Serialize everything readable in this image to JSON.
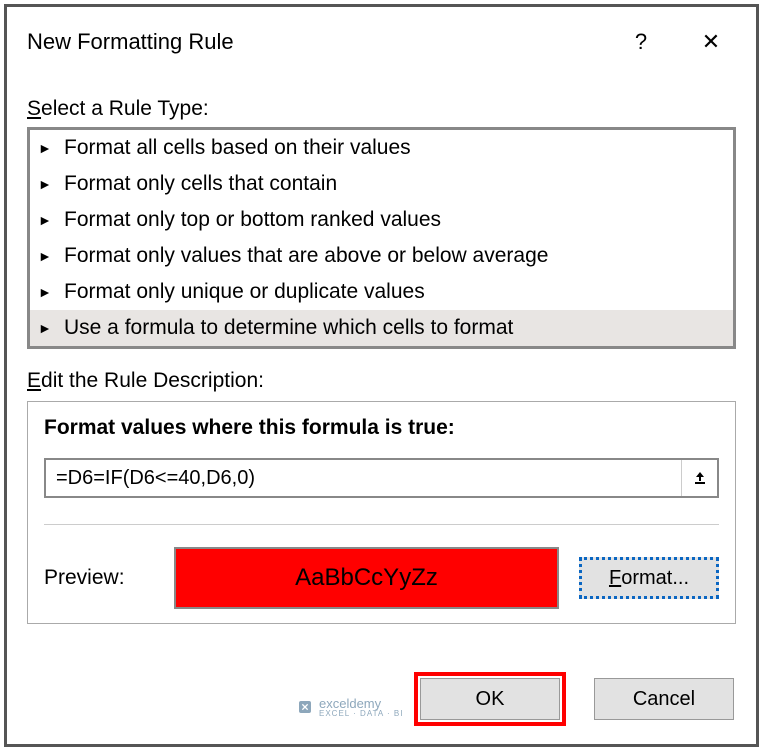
{
  "titlebar": {
    "title": "New Formatting Rule",
    "help": "?",
    "close": "✕"
  },
  "ruleType": {
    "label_pre": "S",
    "label_post": "elect a Rule Type:",
    "items": [
      "Format all cells based on their values",
      "Format only cells that contain",
      "Format only top or bottom ranked values",
      "Format only values that are above or below average",
      "Format only unique or duplicate values",
      "Use a formula to determine which cells to format"
    ]
  },
  "ruleDesc": {
    "label_pre": "E",
    "label_post": "dit the Rule Description:",
    "formulaLabel": "Format values where this formula is true:",
    "formulaValue": "=D6=IF(D6<=40,D6,0)",
    "previewLabel": "Preview:",
    "previewSample": "AaBbCcYyZz",
    "formatBtn_u": "F",
    "formatBtn_post": "ormat..."
  },
  "buttons": {
    "ok": "OK",
    "cancel": "Cancel"
  },
  "watermark": {
    "brand": "exceldemy",
    "tagline": "EXCEL · DATA · BI"
  }
}
